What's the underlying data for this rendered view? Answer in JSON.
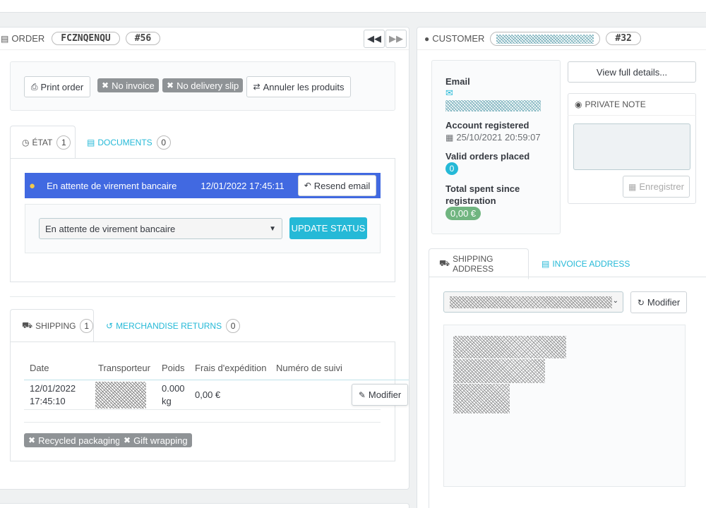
{
  "order": {
    "header_label": "ORDER",
    "reference": "FCZNQENQU",
    "id": "#56",
    "buttons": {
      "print": "Print order",
      "no_invoice": "No invoice",
      "no_delivery": "No delivery slip",
      "cancel_products": "Annuler les produits"
    },
    "tabs": [
      {
        "label": "ÉTAT",
        "count": "1"
      },
      {
        "label": "DOCUMENTS",
        "count": "0"
      }
    ],
    "status": {
      "name": "En attente de virement bancaire",
      "date": "12/01/2022 17:45:11",
      "resend_label": "Resend email"
    },
    "status_select": "En attente de virement bancaire",
    "update_status_label": "UPDATE STATUS",
    "shipping_tabs": [
      {
        "label": "SHIPPING",
        "count": "1"
      },
      {
        "label": "MERCHANDISE RETURNS",
        "count": "0"
      }
    ],
    "shipping_table": {
      "headers": [
        "Date",
        "Transporteur",
        "Poids",
        "Frais d'expédition",
        "Numéro de suivi"
      ],
      "rows": [
        {
          "date_line1": "12/01/2022",
          "date_line2": "17:45:10",
          "weight_line1": "0.000",
          "weight_line2": "kg",
          "cost": "0,00 €",
          "action": "Modifier"
        }
      ]
    },
    "options": {
      "recycled": "Recycled packaging",
      "gift": "Gift wrapping"
    }
  },
  "customer": {
    "header_label": "CUSTOMER",
    "id": "#32",
    "email_label": "Email",
    "account_label": "Account registered",
    "account_date": "25/10/2021 20:59:07",
    "valid_orders_label": "Valid orders placed",
    "valid_orders": "0",
    "total_spent_label_1": "Total spent since",
    "total_spent_label_2": "registration",
    "total_spent": "0,00 €",
    "view_details": "View full details...",
    "private_note_label": "PRIVATE NOTE",
    "save_label": "Enregistrer",
    "address_tabs": [
      {
        "label": "SHIPPING ADDRESS"
      },
      {
        "label": "INVOICE ADDRESS"
      }
    ],
    "modify_label": "Modifier"
  },
  "colors": {
    "accent": "#25b9d7",
    "status_bg": "#4169e1",
    "success": "#70b580",
    "tag": "#8f9396"
  }
}
